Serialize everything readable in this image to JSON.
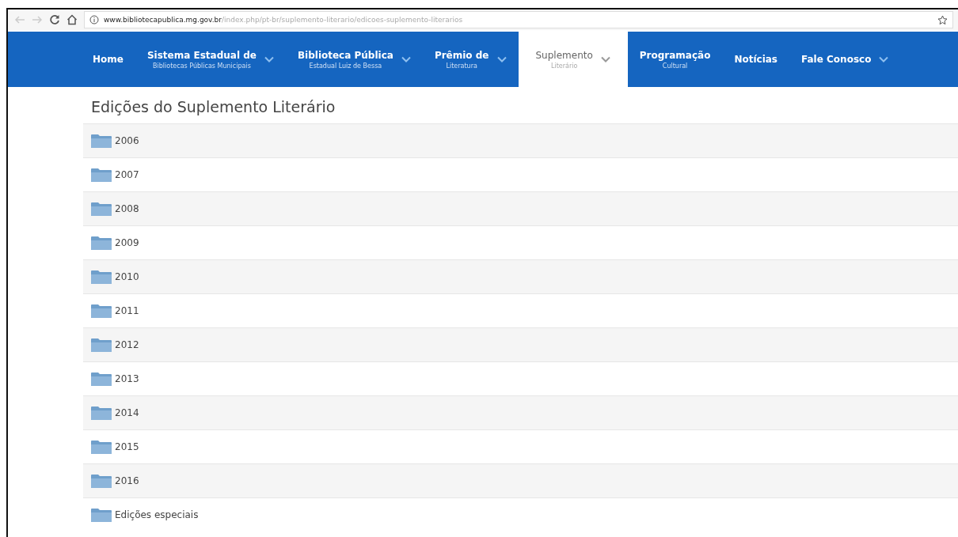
{
  "browser": {
    "url_host": "www.bibliotecapublica.mg.gov.br",
    "url_path": "/index.php/pt-br/suplemento-literario/edicoes-suplemento-literarios"
  },
  "nav": [
    {
      "label": "Home",
      "selected": false,
      "dropdown": false
    },
    {
      "label": "Sistema Estadual de",
      "sublabel": "Bibliotecas Públicas Municipais",
      "selected": false,
      "dropdown": true
    },
    {
      "label": "Biblioteca Pública",
      "sublabel": "Estadual Luiz de Bessa",
      "selected": false,
      "dropdown": true
    },
    {
      "label": "Prêmio de",
      "sublabel": "Literatura",
      "selected": false,
      "dropdown": true
    },
    {
      "label": "Suplemento",
      "sublabel": "Literário",
      "selected": true,
      "dropdown": true
    },
    {
      "label": "Programação",
      "sublabel": "Cultural",
      "selected": false,
      "dropdown": false
    },
    {
      "label": "Notícias",
      "selected": false,
      "dropdown": false
    },
    {
      "label": "Fale Conosco",
      "selected": false,
      "dropdown": true
    }
  ],
  "heading": "Edições do Suplemento Literário",
  "folders": [
    {
      "label": "2006"
    },
    {
      "label": "2007"
    },
    {
      "label": "2008"
    },
    {
      "label": "2009"
    },
    {
      "label": "2010"
    },
    {
      "label": "2011"
    },
    {
      "label": "2012"
    },
    {
      "label": "2013"
    },
    {
      "label": "2014"
    },
    {
      "label": "2015"
    },
    {
      "label": "2016"
    },
    {
      "label": "Edições especiais"
    }
  ]
}
